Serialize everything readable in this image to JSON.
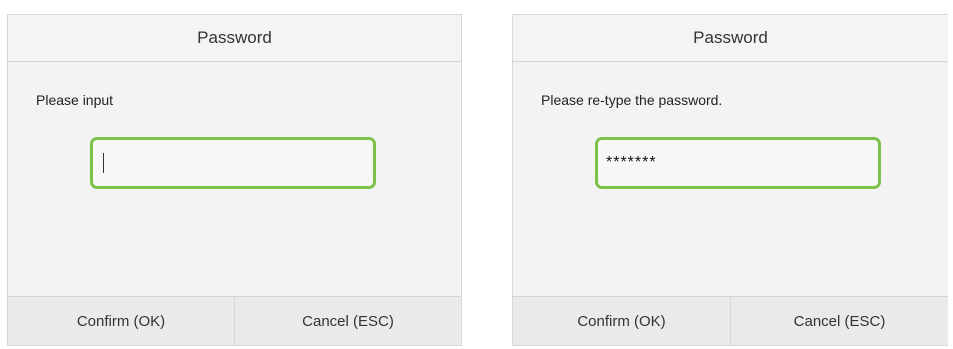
{
  "dialogs": [
    {
      "title": "Password",
      "prompt": "Please input",
      "input_value": "",
      "confirm_label": "Confirm (OK)",
      "cancel_label": "Cancel (ESC)"
    },
    {
      "title": "Password",
      "prompt": "Please re-type the password.",
      "input_value": "*******",
      "confirm_label": "Confirm (OK)",
      "cancel_label": "Cancel (ESC)"
    }
  ],
  "colors": {
    "input_border": "#7dc14a",
    "dialog_bg": "#f3f3f3",
    "footer_bg": "#eaeaea"
  }
}
